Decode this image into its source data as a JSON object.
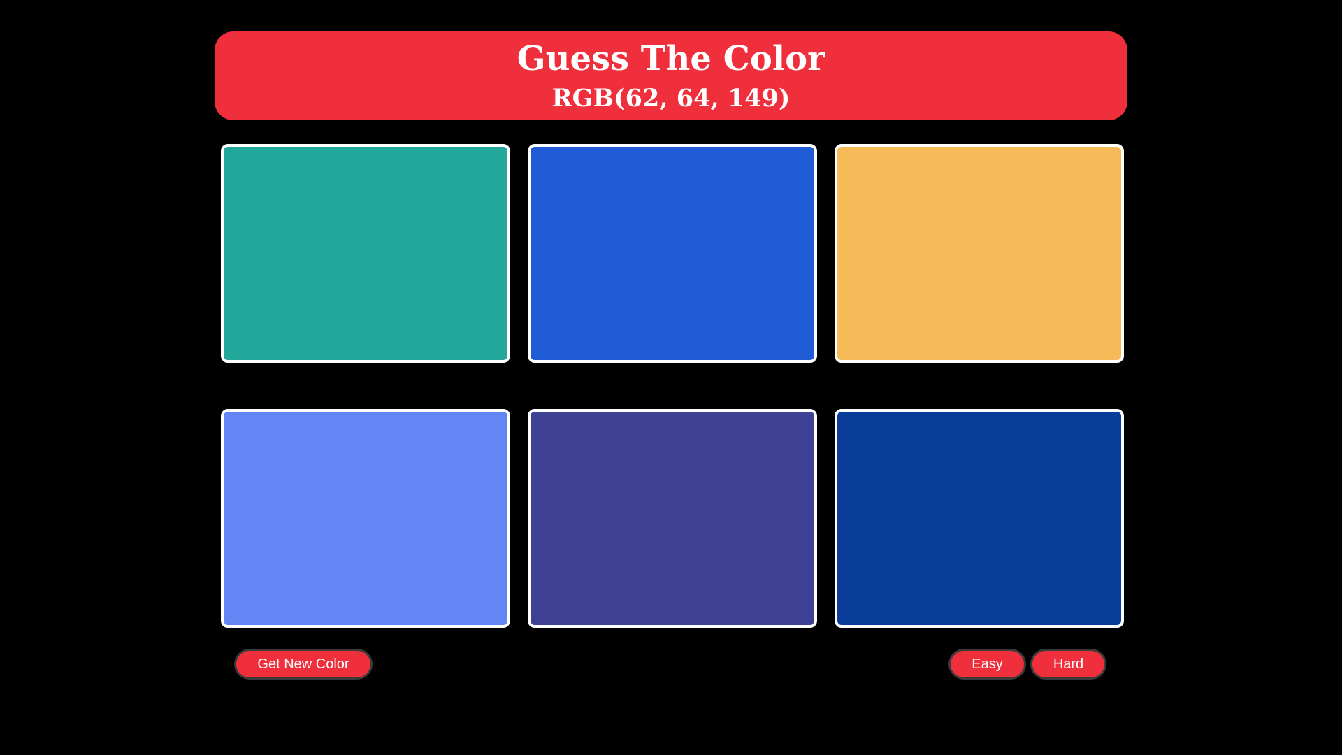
{
  "header": {
    "title": "Guess The Color",
    "rgb_text": "RGB(62, 64, 149)"
  },
  "colors": {
    "header_bg": "#ef2f3c",
    "page_bg": "#000000",
    "swatch_border": "#ffffff"
  },
  "swatches": [
    {
      "color": "#22a79a"
    },
    {
      "color": "#1e5bd4"
    },
    {
      "color": "#f6bb58"
    },
    {
      "color": "#6286f4"
    },
    {
      "color": "#3f4195"
    },
    {
      "color": "#0a3d9a"
    }
  ],
  "controls": {
    "new_color_label": "Get New Color",
    "easy_label": "Easy",
    "hard_label": "Hard"
  }
}
